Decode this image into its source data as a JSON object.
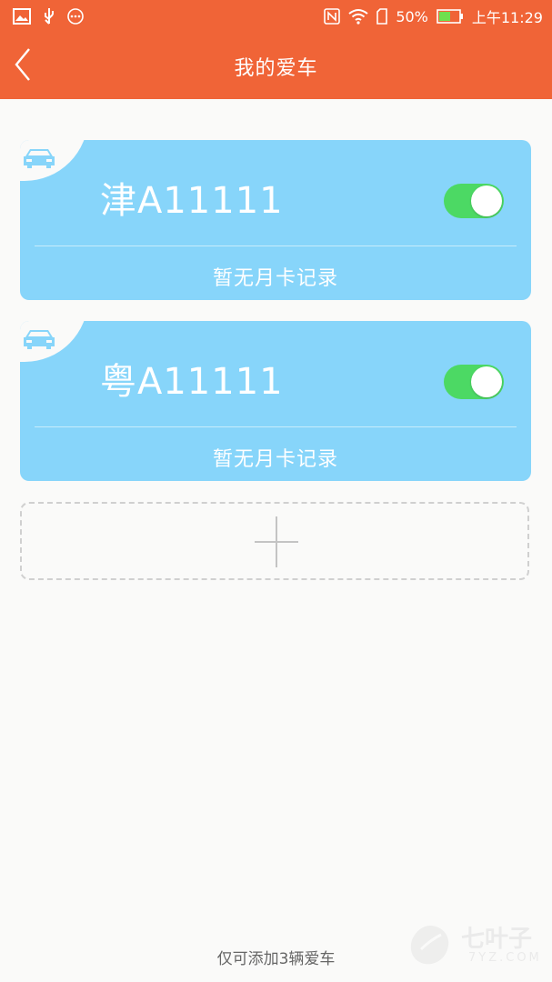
{
  "status_bar": {
    "battery": "50%",
    "time": "上午11:29"
  },
  "header": {
    "title": "我的爱车"
  },
  "cars": [
    {
      "plate": "津A11111",
      "monthly_card": "暂无月卡记录",
      "enabled": true
    },
    {
      "plate": "粤A11111",
      "monthly_card": "暂无月卡记录",
      "enabled": true
    }
  ],
  "footer": {
    "note": "仅可添加3辆爱车"
  },
  "watermark": {
    "brand": "七叶子",
    "domain": "7YZ.COM"
  },
  "colors": {
    "header": "#f06437",
    "card": "#87d5fa",
    "toggle_on": "#4cd964"
  }
}
